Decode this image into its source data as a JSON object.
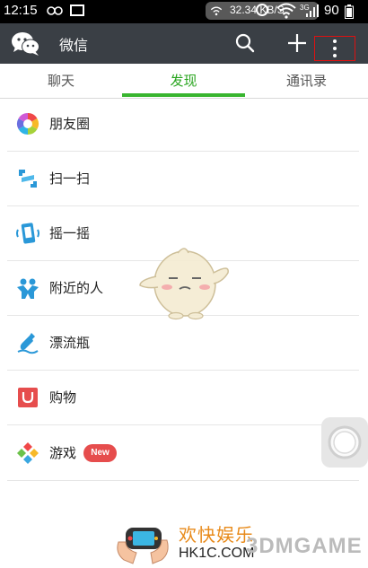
{
  "status_bar": {
    "time": "12:15",
    "speed": "32.34 KB/S",
    "network_type": "3G",
    "battery": "90"
  },
  "app_bar": {
    "title": "微信",
    "icons": [
      "wechat-logo-icon",
      "search-icon",
      "plus-icon",
      "more-icon"
    ]
  },
  "tabs": [
    {
      "label": "聊天",
      "active": false
    },
    {
      "label": "发现",
      "active": true
    },
    {
      "label": "通讯录",
      "active": false
    }
  ],
  "discover_items": [
    {
      "label": "朋友圈",
      "icon": "moments-icon"
    },
    {
      "label": "扫一扫",
      "icon": "scan-icon"
    },
    {
      "label": "摇一摇",
      "icon": "shake-icon"
    },
    {
      "label": "附近的人",
      "icon": "people-nearby-icon"
    },
    {
      "label": "漂流瓶",
      "icon": "drift-bottle-icon"
    },
    {
      "label": "购物",
      "icon": "shopping-icon"
    },
    {
      "label": "游戏",
      "icon": "games-icon",
      "badge": "New"
    }
  ],
  "watermark": {
    "cn_text": "欢快娱乐",
    "site": "HK1C.COM",
    "brand": "3DMGAME"
  },
  "colors": {
    "app_bar": "#3a3f45",
    "accent_green": "#38b52f",
    "badge_red": "#e64d4d",
    "highlight_box": "#dd1111"
  }
}
